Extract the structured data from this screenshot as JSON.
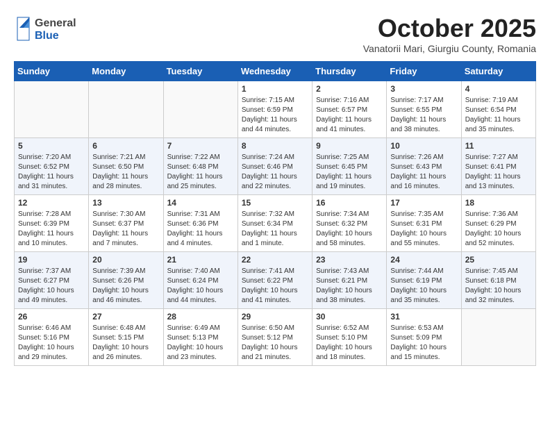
{
  "header": {
    "logo_general": "General",
    "logo_blue": "Blue",
    "month_title": "October 2025",
    "location": "Vanatorii Mari, Giurgiu County, Romania"
  },
  "weekdays": [
    "Sunday",
    "Monday",
    "Tuesday",
    "Wednesday",
    "Thursday",
    "Friday",
    "Saturday"
  ],
  "weeks": [
    [
      {
        "day": "",
        "sunrise": "",
        "sunset": "",
        "daylight": ""
      },
      {
        "day": "",
        "sunrise": "",
        "sunset": "",
        "daylight": ""
      },
      {
        "day": "",
        "sunrise": "",
        "sunset": "",
        "daylight": ""
      },
      {
        "day": "1",
        "sunrise": "Sunrise: 7:15 AM",
        "sunset": "Sunset: 6:59 PM",
        "daylight": "Daylight: 11 hours and 44 minutes."
      },
      {
        "day": "2",
        "sunrise": "Sunrise: 7:16 AM",
        "sunset": "Sunset: 6:57 PM",
        "daylight": "Daylight: 11 hours and 41 minutes."
      },
      {
        "day": "3",
        "sunrise": "Sunrise: 7:17 AM",
        "sunset": "Sunset: 6:55 PM",
        "daylight": "Daylight: 11 hours and 38 minutes."
      },
      {
        "day": "4",
        "sunrise": "Sunrise: 7:19 AM",
        "sunset": "Sunset: 6:54 PM",
        "daylight": "Daylight: 11 hours and 35 minutes."
      }
    ],
    [
      {
        "day": "5",
        "sunrise": "Sunrise: 7:20 AM",
        "sunset": "Sunset: 6:52 PM",
        "daylight": "Daylight: 11 hours and 31 minutes."
      },
      {
        "day": "6",
        "sunrise": "Sunrise: 7:21 AM",
        "sunset": "Sunset: 6:50 PM",
        "daylight": "Daylight: 11 hours and 28 minutes."
      },
      {
        "day": "7",
        "sunrise": "Sunrise: 7:22 AM",
        "sunset": "Sunset: 6:48 PM",
        "daylight": "Daylight: 11 hours and 25 minutes."
      },
      {
        "day": "8",
        "sunrise": "Sunrise: 7:24 AM",
        "sunset": "Sunset: 6:46 PM",
        "daylight": "Daylight: 11 hours and 22 minutes."
      },
      {
        "day": "9",
        "sunrise": "Sunrise: 7:25 AM",
        "sunset": "Sunset: 6:45 PM",
        "daylight": "Daylight: 11 hours and 19 minutes."
      },
      {
        "day": "10",
        "sunrise": "Sunrise: 7:26 AM",
        "sunset": "Sunset: 6:43 PM",
        "daylight": "Daylight: 11 hours and 16 minutes."
      },
      {
        "day": "11",
        "sunrise": "Sunrise: 7:27 AM",
        "sunset": "Sunset: 6:41 PM",
        "daylight": "Daylight: 11 hours and 13 minutes."
      }
    ],
    [
      {
        "day": "12",
        "sunrise": "Sunrise: 7:28 AM",
        "sunset": "Sunset: 6:39 PM",
        "daylight": "Daylight: 11 hours and 10 minutes."
      },
      {
        "day": "13",
        "sunrise": "Sunrise: 7:30 AM",
        "sunset": "Sunset: 6:37 PM",
        "daylight": "Daylight: 11 hours and 7 minutes."
      },
      {
        "day": "14",
        "sunrise": "Sunrise: 7:31 AM",
        "sunset": "Sunset: 6:36 PM",
        "daylight": "Daylight: 11 hours and 4 minutes."
      },
      {
        "day": "15",
        "sunrise": "Sunrise: 7:32 AM",
        "sunset": "Sunset: 6:34 PM",
        "daylight": "Daylight: 11 hours and 1 minute."
      },
      {
        "day": "16",
        "sunrise": "Sunrise: 7:34 AM",
        "sunset": "Sunset: 6:32 PM",
        "daylight": "Daylight: 10 hours and 58 minutes."
      },
      {
        "day": "17",
        "sunrise": "Sunrise: 7:35 AM",
        "sunset": "Sunset: 6:31 PM",
        "daylight": "Daylight: 10 hours and 55 minutes."
      },
      {
        "day": "18",
        "sunrise": "Sunrise: 7:36 AM",
        "sunset": "Sunset: 6:29 PM",
        "daylight": "Daylight: 10 hours and 52 minutes."
      }
    ],
    [
      {
        "day": "19",
        "sunrise": "Sunrise: 7:37 AM",
        "sunset": "Sunset: 6:27 PM",
        "daylight": "Daylight: 10 hours and 49 minutes."
      },
      {
        "day": "20",
        "sunrise": "Sunrise: 7:39 AM",
        "sunset": "Sunset: 6:26 PM",
        "daylight": "Daylight: 10 hours and 46 minutes."
      },
      {
        "day": "21",
        "sunrise": "Sunrise: 7:40 AM",
        "sunset": "Sunset: 6:24 PM",
        "daylight": "Daylight: 10 hours and 44 minutes."
      },
      {
        "day": "22",
        "sunrise": "Sunrise: 7:41 AM",
        "sunset": "Sunset: 6:22 PM",
        "daylight": "Daylight: 10 hours and 41 minutes."
      },
      {
        "day": "23",
        "sunrise": "Sunrise: 7:43 AM",
        "sunset": "Sunset: 6:21 PM",
        "daylight": "Daylight: 10 hours and 38 minutes."
      },
      {
        "day": "24",
        "sunrise": "Sunrise: 7:44 AM",
        "sunset": "Sunset: 6:19 PM",
        "daylight": "Daylight: 10 hours and 35 minutes."
      },
      {
        "day": "25",
        "sunrise": "Sunrise: 7:45 AM",
        "sunset": "Sunset: 6:18 PM",
        "daylight": "Daylight: 10 hours and 32 minutes."
      }
    ],
    [
      {
        "day": "26",
        "sunrise": "Sunrise: 6:46 AM",
        "sunset": "Sunset: 5:16 PM",
        "daylight": "Daylight: 10 hours and 29 minutes."
      },
      {
        "day": "27",
        "sunrise": "Sunrise: 6:48 AM",
        "sunset": "Sunset: 5:15 PM",
        "daylight": "Daylight: 10 hours and 26 minutes."
      },
      {
        "day": "28",
        "sunrise": "Sunrise: 6:49 AM",
        "sunset": "Sunset: 5:13 PM",
        "daylight": "Daylight: 10 hours and 23 minutes."
      },
      {
        "day": "29",
        "sunrise": "Sunrise: 6:50 AM",
        "sunset": "Sunset: 5:12 PM",
        "daylight": "Daylight: 10 hours and 21 minutes."
      },
      {
        "day": "30",
        "sunrise": "Sunrise: 6:52 AM",
        "sunset": "Sunset: 5:10 PM",
        "daylight": "Daylight: 10 hours and 18 minutes."
      },
      {
        "day": "31",
        "sunrise": "Sunrise: 6:53 AM",
        "sunset": "Sunset: 5:09 PM",
        "daylight": "Daylight: 10 hours and 15 minutes."
      },
      {
        "day": "",
        "sunrise": "",
        "sunset": "",
        "daylight": ""
      }
    ]
  ]
}
